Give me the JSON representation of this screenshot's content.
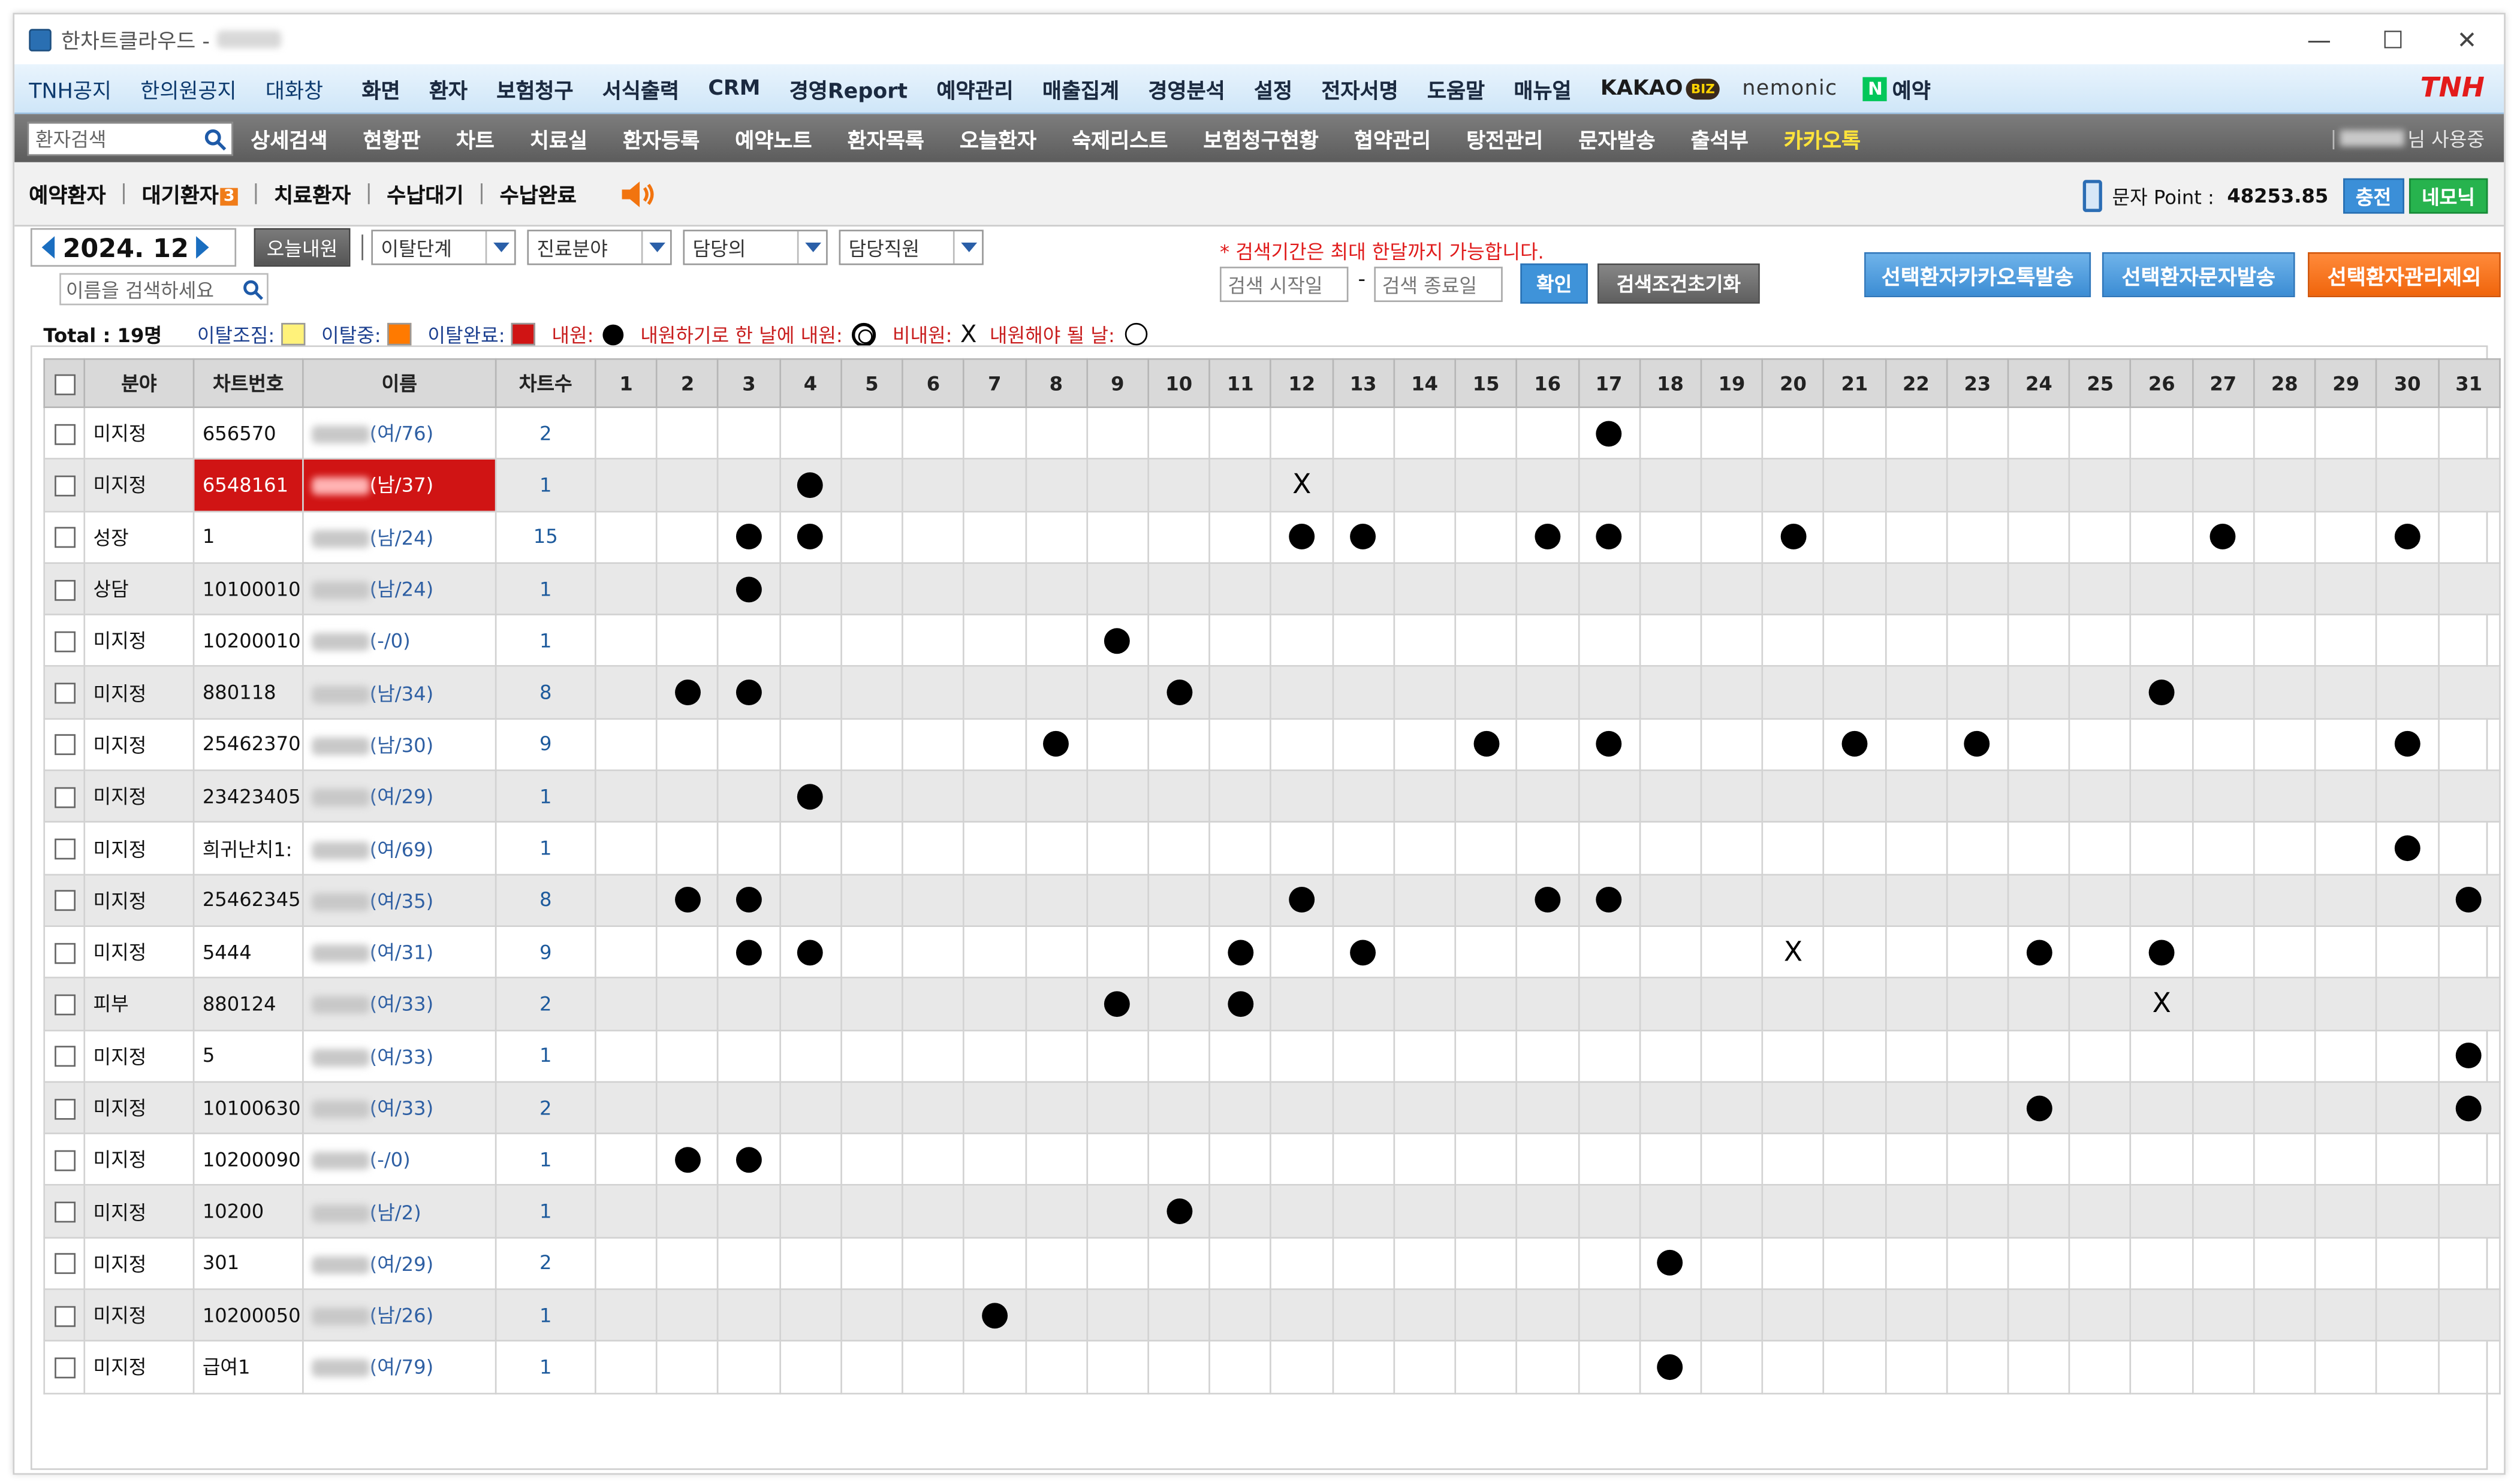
{
  "window": {
    "title": "한차트클라우드 -"
  },
  "menu1": [
    "화면",
    "환자",
    "보험청구",
    "서식출력",
    "CRM",
    "경영Report",
    "예약관리",
    "매출집계",
    "경영분석",
    "설정",
    "전자서명",
    "도움말",
    "매뉴얼"
  ],
  "menu1_left": [
    "TNH공지",
    "한의원공지",
    "대화창"
  ],
  "menu1_brands": {
    "kakao": "KAKAO",
    "biz": "BIZ",
    "nemonic": "nemonic",
    "naver_n": "N",
    "naver_label": "예약",
    "tnh": "TNH"
  },
  "menu2": {
    "search_placeholder": "환자검색",
    "items": [
      "상세검색",
      "현황판",
      "차트",
      "치료실",
      "환자등록",
      "예약노트",
      "환자목록",
      "오늘환자",
      "숙제리스트",
      "보험청구현황",
      "협약관리",
      "탕전관리",
      "문자발송",
      "출석부",
      "카카오톡"
    ],
    "user_suffix": "님 사용중"
  },
  "tabs": {
    "items": [
      "예약환자",
      "대기환자",
      "치료환자",
      "수납대기",
      "수납완료"
    ],
    "waiting_count": "3",
    "sms_label": "문자 Point :",
    "sms_value": "48253.85",
    "charge_btn": "충전",
    "nemonic_btn": "네모닉"
  },
  "filters": {
    "month": "2024. 12",
    "today_btn": "오늘내원",
    "selects": [
      "이탈단계",
      "진료분야",
      "담당의",
      "담당직원"
    ],
    "name_placeholder": "이름을 검색하세요",
    "note": "* 검색기간은 최대 한달까지 가능합니다.",
    "start_placeholder": "검색 시작일",
    "end_placeholder": "검색 종료일",
    "dash": "-",
    "confirm_btn": "확인",
    "reset_btn": "검색조건초기화",
    "kakao_btn": "선택환자카카오톡발송",
    "sms_btn": "선택환자문자발송",
    "exclude_btn": "선택환자관리제외"
  },
  "legend": {
    "total": "Total : 19명",
    "l1": "이탈조짐:",
    "l2": "이탈중:",
    "l3": "이탈완료:",
    "l4": "내원:",
    "l5": "내원하기로 한 날에 내원:",
    "l6": "비내원:",
    "l7": "내원해야 될 날:",
    "x": "X",
    "c1": "#fff27a",
    "c2": "#ff7a00",
    "c3": "#d01414"
  },
  "grid": {
    "headers": {
      "field": "분야",
      "chart_no": "차트번호",
      "name": "이름",
      "count": "차트수"
    },
    "days": [
      "1",
      "2",
      "3",
      "4",
      "5",
      "6",
      "7",
      "8",
      "9",
      "10",
      "11",
      "12",
      "13",
      "14",
      "15",
      "16",
      "17",
      "18",
      "19",
      "20",
      "21",
      "22",
      "23",
      "24",
      "25",
      "26",
      "27",
      "28",
      "29",
      "30",
      "31"
    ],
    "sat": [
      7,
      14,
      21,
      28
    ],
    "sun": [
      1,
      8,
      15,
      22,
      29
    ],
    "rows": [
      {
        "field": "미지정",
        "chart": "656570",
        "age": "(여/76)",
        "count": "2",
        "marks": {
          "17": "o"
        }
      },
      {
        "field": "미지정",
        "chart": "6548161",
        "age": "(남/37)",
        "count": "1",
        "marks": {
          "4": "o",
          "12": "x"
        },
        "hl": true
      },
      {
        "field": "성장",
        "chart": "1",
        "age": "(남/24)",
        "count": "15",
        "marks": {
          "3": "o",
          "4": "o",
          "12": "o",
          "13": "o",
          "16": "o",
          "17": "o",
          "20": "o",
          "27": "o",
          "30": "o"
        }
      },
      {
        "field": "상담",
        "chart": "10100010",
        "age": "(남/24)",
        "count": "1",
        "marks": {
          "3": "o"
        }
      },
      {
        "field": "미지정",
        "chart": "10200010",
        "age": "(-/0)",
        "count": "1",
        "marks": {
          "9": "o"
        }
      },
      {
        "field": "미지정",
        "chart": "880118",
        "age": "(남/34)",
        "count": "8",
        "marks": {
          "2": "o",
          "3": "o",
          "10": "o",
          "26": "o"
        }
      },
      {
        "field": "미지정",
        "chart": "25462370",
        "age": "(남/30)",
        "count": "9",
        "marks": {
          "8": "o",
          "15": "o",
          "17": "o",
          "21": "o",
          "23": "o",
          "30": "o"
        }
      },
      {
        "field": "미지정",
        "chart": "23423405",
        "age": "(여/29)",
        "count": "1",
        "marks": {
          "4": "o"
        }
      },
      {
        "field": "미지정",
        "chart": "희귀난치1:",
        "age": "(여/69)",
        "count": "1",
        "marks": {
          "30": "o"
        }
      },
      {
        "field": "미지정",
        "chart": "25462345",
        "age": "(여/35)",
        "count": "8",
        "marks": {
          "2": "o",
          "3": "o",
          "12": "o",
          "16": "o",
          "17": "o",
          "31": "o"
        }
      },
      {
        "field": "미지정",
        "chart": "5444",
        "age": "(여/31)",
        "count": "9",
        "marks": {
          "3": "o",
          "4": "o",
          "11": "o",
          "13": "o",
          "20": "x",
          "24": "o",
          "26": "o"
        }
      },
      {
        "field": "피부",
        "chart": "880124",
        "age": "(여/33)",
        "count": "2",
        "marks": {
          "9": "o",
          "11": "o",
          "26": "x"
        }
      },
      {
        "field": "미지정",
        "chart": "5",
        "age": "(여/33)",
        "count": "1",
        "marks": {
          "31": "o"
        }
      },
      {
        "field": "미지정",
        "chart": "10100630",
        "age": "(여/33)",
        "count": "2",
        "marks": {
          "24": "o",
          "31": "o"
        }
      },
      {
        "field": "미지정",
        "chart": "10200090",
        "age": "(-/0)",
        "count": "1",
        "marks": {
          "2": "o",
          "3": "o"
        }
      },
      {
        "field": "미지정",
        "chart": "10200",
        "age": "(남/2)",
        "count": "1",
        "marks": {
          "10": "o"
        }
      },
      {
        "field": "미지정",
        "chart": "301",
        "age": "(여/29)",
        "count": "2",
        "marks": {
          "18": "o"
        }
      },
      {
        "field": "미지정",
        "chart": "10200050",
        "age": "(남/26)",
        "count": "1",
        "marks": {
          "7": "o"
        }
      },
      {
        "field": "미지정",
        "chart": "급여1",
        "age": "(여/79)",
        "count": "1",
        "marks": {
          "18": "o"
        }
      }
    ]
  }
}
